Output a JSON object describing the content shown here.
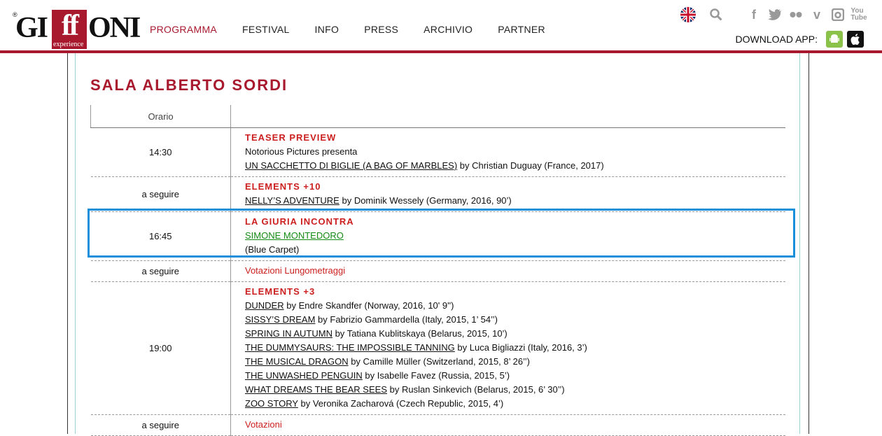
{
  "nav": [
    "PROGRAMMA",
    "FESTIVAL",
    "INFO",
    "PRESS",
    "ARCHIVIO",
    "PARTNER"
  ],
  "header": {
    "logo_text": "GIFFONI experience",
    "download_label": "DOWNLOAD APP:",
    "icons": [
      "uk-flag-icon",
      "search-icon",
      "facebook-icon",
      "twitter-icon",
      "flickr-icon",
      "vimeo-icon",
      "instagram-icon",
      "youtube-icon",
      "android-icon",
      "apple-icon"
    ]
  },
  "title": "SALA ALBERTO SORDI",
  "table": {
    "header_orario": "Orario",
    "rows": [
      {
        "time": "14:30",
        "category": "TEASER PREVIEW",
        "lines": [
          {
            "text": "Notorious Pictures presenta"
          },
          {
            "film": "UN SACCHETTO DI BIGLIE (A BAG OF MARBLES)",
            "info": " by Christian Duguay (France, 2017)"
          }
        ]
      },
      {
        "time": "a seguire",
        "category": "ELEMENTS +10",
        "lines": [
          {
            "film": "NELLY’S ADVENTURE",
            "info": " by Dominik Wessely (Germany, 2016, 90’)"
          }
        ]
      },
      {
        "time": "16:45",
        "category": "LA GIURIA INCONTRA",
        "highlight_link": "SIMONE MONTEDORO",
        "note": "(Blue Carpet)"
      },
      {
        "time": "a seguire",
        "red_text": "Votazioni Lungometraggi"
      },
      {
        "time": "19:00",
        "category": "ELEMENTS +3",
        "lines": [
          {
            "film": "DUNDER",
            "info": " by Endre Skandfer (Norway, 2016, 10' 9'')"
          },
          {
            "film": "SISSY’S DREAM",
            "info": " by Fabrizio Gammardella (Italy, 2015, 1’ 54’’)"
          },
          {
            "film": "SPRING IN AUTUMN",
            "info": " by Tatiana Kublitskaya (Belarus, 2015, 10’)"
          },
          {
            "film": "THE DUMMYSAURS: THE IMPOSSIBLE TANNING",
            "info": " by Luca Bigliazzi (Italy, 2016, 3’)"
          },
          {
            "film": "THE MUSICAL DRAGON",
            "info": " by Camille Müller (Switzerland, 2015, 8’ 26’’)"
          },
          {
            "film": "THE UNWASHED PENGUIN",
            "info": " by Isabelle Favez (Russia, 2015, 5’)"
          },
          {
            "film": "WHAT DREAMS THE BEAR SEES",
            "info": " by Ruslan Sinkevich (Belarus, 2015, 6’ 30’’)"
          },
          {
            "film": "ZOO STORY",
            "info": " by Veronika Zacharová (Czech Republic, 2015, 4’)"
          }
        ]
      },
      {
        "time": "a seguire",
        "red_text": "Votazioni"
      }
    ]
  }
}
